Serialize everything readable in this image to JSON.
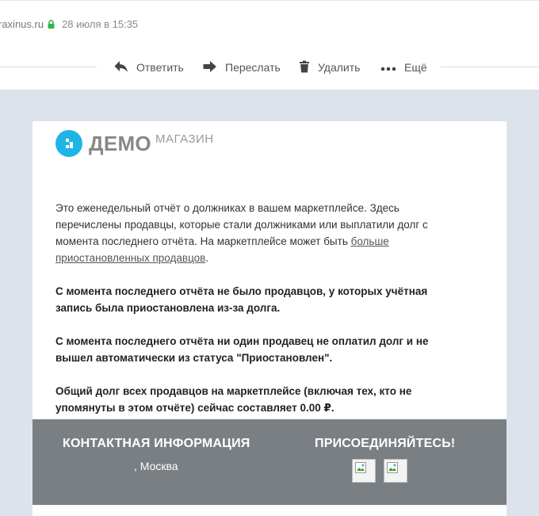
{
  "header": {
    "sender": "raxinus.ru",
    "date": "28 июля в 15:35"
  },
  "toolbar": {
    "reply": "Ответить",
    "forward": "Переслать",
    "delete": "Удалить",
    "more": "Ещё"
  },
  "logo": {
    "main": "ДЕМО",
    "sub": "МАГАЗИН"
  },
  "email": {
    "intro": "Это еженедельный отчёт о должниках в вашем маркетплейсе. Здесь перечислены продавцы, которые стали должниками или выплатили долг с момента последнего отчёта. На маркетплейсе может быть ",
    "intro_link": "больше приостановленных продавцов",
    "intro_end": ".",
    "para_suspended": "С момента последнего отчёта не было продавцов, у которых учётная запись была приостановлена из-за долга.",
    "para_paid": "С момента последнего отчёта ни один продавец не оплатил долг и не вышел автоматически из статуса \"Приостановлен\".",
    "para_total": "Общий долг всех продавцов на маркетплейсе (включая тех, кто не упомянуты в этом отчёте) сейчас составляет 0.00 ₽."
  },
  "footer": {
    "contact_title": "КОНТАКТНАЯ ИНФОРМАЦИЯ",
    "city": ", Москва",
    "join_title": "ПРИСОЕДИНЯЙТЕСЬ!"
  },
  "colors": {
    "accent": "#1fb4e6",
    "lock": "#2fb44a",
    "footer_bg": "#7a7f84",
    "mail_bg": "#dde3ea"
  }
}
